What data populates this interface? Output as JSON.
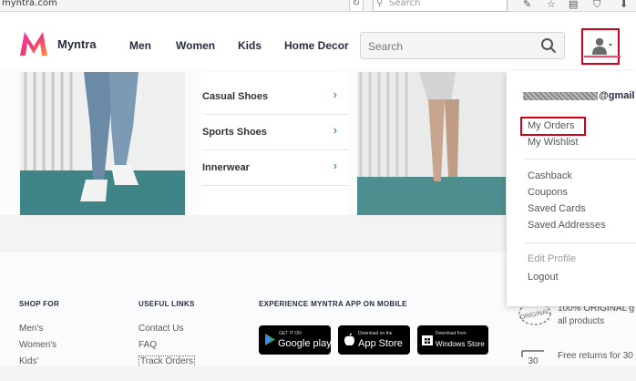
{
  "browser": {
    "url": "myntra.com",
    "search_placeholder": "Search"
  },
  "header": {
    "brand": "Myntra",
    "nav": [
      "Men",
      "Women",
      "Kids",
      "Home Decor"
    ],
    "search_placeholder": "Search"
  },
  "categories": [
    "Casual Shoes",
    "Sports Shoes",
    "Innerwear"
  ],
  "dropdown": {
    "email_suffix": "@gmail",
    "orders": "My Orders",
    "wishlist": "My Wishlist",
    "cashback": "Cashback",
    "coupons": "Coupons",
    "saved_cards": "Saved Cards",
    "saved_addresses": "Saved Addresses",
    "edit_profile": "Edit Profile",
    "logout": "Logout"
  },
  "footer": {
    "shop_for": "SHOP FOR",
    "shop_links": [
      "Men's",
      "Women's",
      "Kids'"
    ],
    "useful_links": "USEFUL LINKS",
    "useful": [
      "Contact Us",
      "FAQ",
      "Track Orders"
    ],
    "app_heading": "EXPERIENCE MYNTRA APP ON MOBILE",
    "google": {
      "small": "GET IT ON",
      "big": "Google play"
    },
    "apple": {
      "small": "Download on the",
      "big": "App Store"
    },
    "windows": {
      "small": "Download from",
      "big": "Windows Store"
    },
    "original_badge": "ORIGINAL",
    "original_text_1": "100% ORIGINAL g",
    "original_text_2": "all products",
    "returns_number": "30",
    "returns_text": "Free returns for 30"
  },
  "colors": {
    "accent": "#ff3f6c",
    "highlight": "#d0021b",
    "nav_text": "#282c3f"
  }
}
